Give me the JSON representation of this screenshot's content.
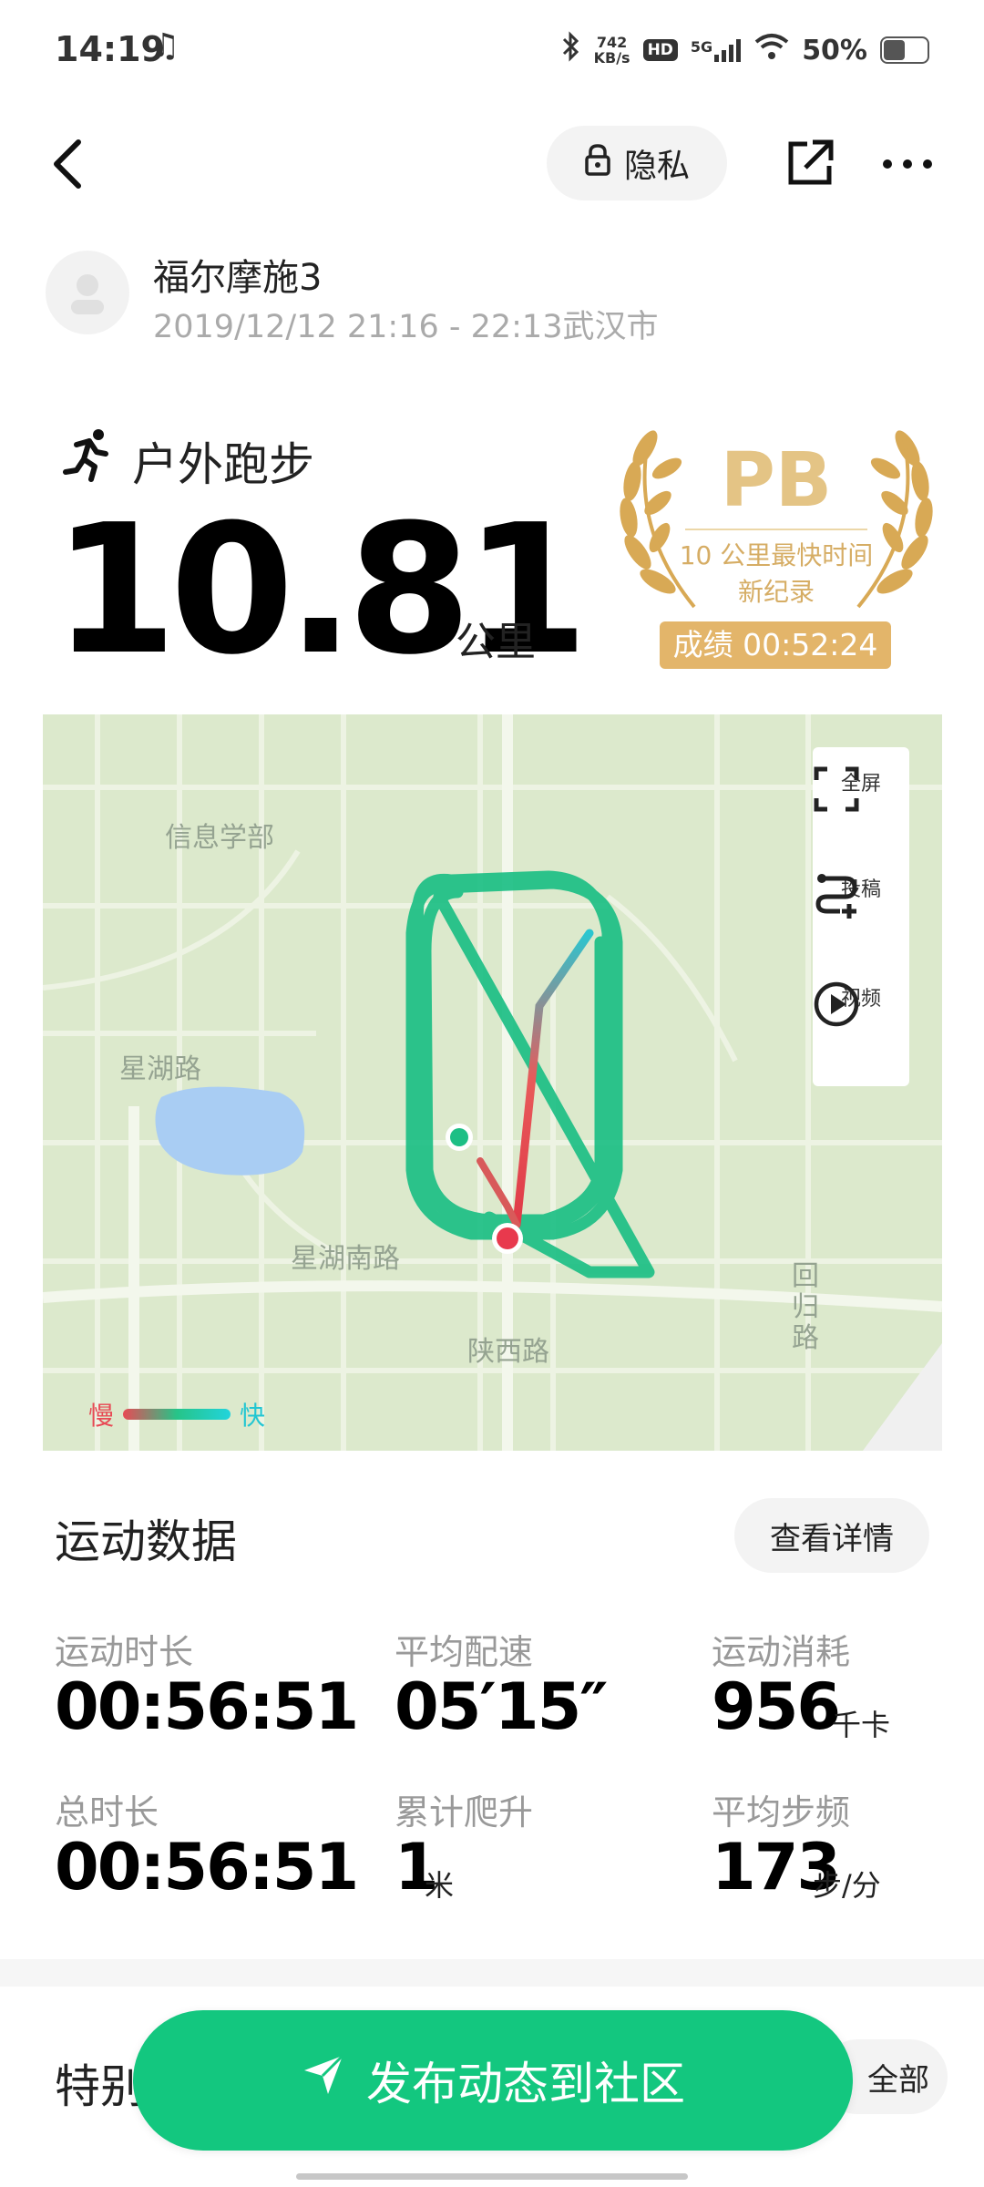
{
  "status_bar": {
    "time": "14:19",
    "net_speed_value": "742",
    "net_speed_unit": "KB/s",
    "hd": "HD",
    "network": "5G",
    "battery": "50%",
    "battery_level": 0.5
  },
  "nav": {
    "privacy_label": "隐私"
  },
  "user": {
    "name": "福尔摩施3",
    "datetime_location": "2019/12/12 21:16 - 22:13武汉市"
  },
  "activity": {
    "type": "户外跑步",
    "distance": "10.81",
    "unit": "公里"
  },
  "pb_badge": {
    "title": "PB",
    "line1": "10 公里最快时间",
    "line2": "新纪录",
    "result": "成绩 00:52:24"
  },
  "map": {
    "labels": {
      "xinxi": "信息学部",
      "xinghu": "星湖路",
      "xinghu_south": "星湖南路",
      "shanxi": "陕西路",
      "huigui": "回归路"
    },
    "tools": {
      "fullscreen": "全屏",
      "submit": "投稿",
      "video": "视频"
    },
    "legend_slow": "慢",
    "legend_fast": "快"
  },
  "stats": {
    "title": "运动数据",
    "details_button": "查看详情",
    "items": [
      {
        "label": "运动时长",
        "value": "00:56:51",
        "unit": ""
      },
      {
        "label": "平均配速",
        "value": "05′15″",
        "unit": ""
      },
      {
        "label": "运动消耗",
        "value": "956",
        "unit": "千卡"
      },
      {
        "label": "总时长",
        "value": "00:56:51",
        "unit": ""
      },
      {
        "label": "累计爬升",
        "value": "1",
        "unit": "米"
      },
      {
        "label": "平均步频",
        "value": "173",
        "unit": "步/分"
      }
    ]
  },
  "special": {
    "title": "特别",
    "all_button": "全部"
  },
  "publish_button": "发布动态到社区",
  "colors": {
    "accent_green": "#13c77f",
    "pb_gold": "#e3b56a",
    "map_bg": "#dce9cc"
  }
}
